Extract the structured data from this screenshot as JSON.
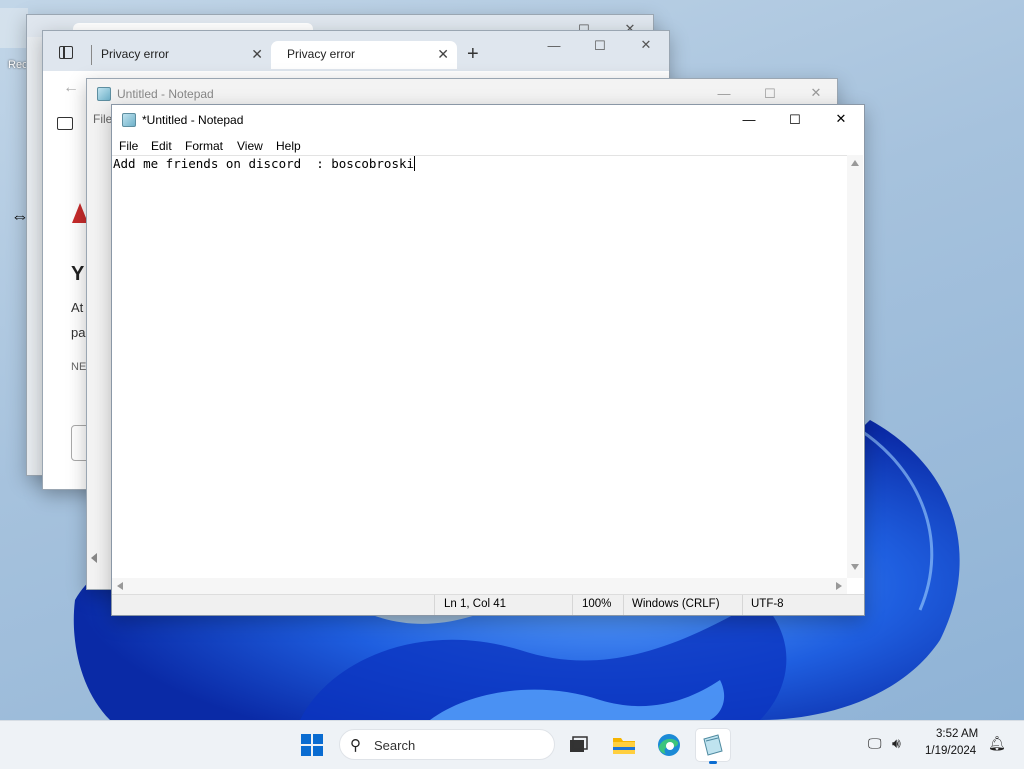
{
  "desktop": {
    "partial_label": "Rec"
  },
  "browser": {
    "tabs": [
      {
        "label": "Privacy error"
      },
      {
        "label": "Privacy error"
      }
    ],
    "error": {
      "heading_partial": "Y",
      "line1_partial": "At",
      "line2_partial": "pa",
      "code_partial": "NE"
    }
  },
  "notepad_back": {
    "title": "Untitled - Notepad",
    "menu_partial": "File"
  },
  "notepad": {
    "title": "*Untitled - Notepad",
    "menu": [
      "File",
      "Edit",
      "Format",
      "View",
      "Help"
    ],
    "content": "Add me friends on discord  : boscobroski",
    "status": {
      "position": "Ln 1, Col 41",
      "zoom": "100%",
      "line_ending": "Windows (CRLF)",
      "encoding": "UTF-8"
    }
  },
  "taskbar": {
    "search_placeholder": "Search",
    "time": "3:52 AM",
    "date": "1/19/2024",
    "pinned": [
      "task-view",
      "file-explorer",
      "edge",
      "notepad"
    ]
  },
  "colors": {
    "accent": "#0a6cd1",
    "bloom_dark": "#0b2fb0",
    "bloom_light": "#2d7ff0"
  }
}
